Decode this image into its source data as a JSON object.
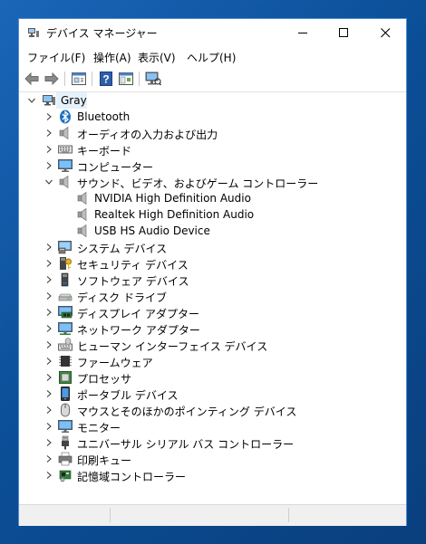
{
  "window": {
    "title": "デバイス マネージャー"
  },
  "menu": [
    {
      "id": "file",
      "label": "ファイル(F)"
    },
    {
      "id": "action",
      "label": "操作(A)"
    },
    {
      "id": "view",
      "label": "表示(V)"
    },
    {
      "id": "help",
      "label": "ヘルプ(H)"
    }
  ],
  "toolbar": [
    {
      "name": "back-icon"
    },
    {
      "name": "forward-icon"
    },
    {
      "name": "properties-icon"
    },
    {
      "name": "help-icon"
    },
    {
      "name": "show-hide-console-tree-icon"
    },
    {
      "name": "scan-hardware-icon"
    }
  ],
  "tree": {
    "root": {
      "label": "Gray",
      "icon": "computer-icon"
    },
    "items": [
      {
        "label": "Bluetooth",
        "icon": "bluetooth-icon",
        "expanded": false
      },
      {
        "label": "オーディオの入力および出力",
        "icon": "speaker-icon",
        "expanded": false
      },
      {
        "label": "キーボード",
        "icon": "keyboard-icon",
        "expanded": false
      },
      {
        "label": "コンピューター",
        "icon": "monitor-icon",
        "expanded": false
      },
      {
        "label": "サウンド、ビデオ、およびゲーム コントローラー",
        "icon": "speaker-icon",
        "expanded": true,
        "children": [
          {
            "label": "NVIDIA High Definition Audio",
            "icon": "speaker-icon"
          },
          {
            "label": "Realtek High Definition Audio",
            "icon": "speaker-icon"
          },
          {
            "label": "USB HS Audio Device",
            "icon": "speaker-icon"
          }
        ]
      },
      {
        "label": "システム デバイス",
        "icon": "system-device-icon",
        "expanded": false
      },
      {
        "label": "セキュリティ デバイス",
        "icon": "security-key-icon",
        "expanded": false
      },
      {
        "label": "ソフトウェア デバイス",
        "icon": "software-device-icon",
        "expanded": false
      },
      {
        "label": "ディスク ドライブ",
        "icon": "disk-drive-icon",
        "expanded": false
      },
      {
        "label": "ディスプレイ アダプター",
        "icon": "display-adapter-icon",
        "expanded": false
      },
      {
        "label": "ネットワーク アダプター",
        "icon": "network-adapter-icon",
        "expanded": false
      },
      {
        "label": "ヒューマン インターフェイス デバイス",
        "icon": "hid-icon",
        "expanded": false
      },
      {
        "label": "ファームウェア",
        "icon": "firmware-chip-icon",
        "expanded": false
      },
      {
        "label": "プロセッサ",
        "icon": "processor-icon",
        "expanded": false
      },
      {
        "label": "ポータブル デバイス",
        "icon": "portable-device-icon",
        "expanded": false
      },
      {
        "label": "マウスとそのほかのポインティング デバイス",
        "icon": "mouse-icon",
        "expanded": false
      },
      {
        "label": "モニター",
        "icon": "monitor-icon",
        "expanded": false
      },
      {
        "label": "ユニバーサル シリアル バス コントローラー",
        "icon": "usb-icon",
        "expanded": false
      },
      {
        "label": "印刷キュー",
        "icon": "printer-icon",
        "expanded": false
      },
      {
        "label": "記憶域コントローラー",
        "icon": "storage-controller-icon",
        "expanded": false
      }
    ]
  },
  "colors": {
    "desktop": "#0b4f98",
    "selection": "#e5f1fb",
    "accent": "#1f70c1"
  }
}
